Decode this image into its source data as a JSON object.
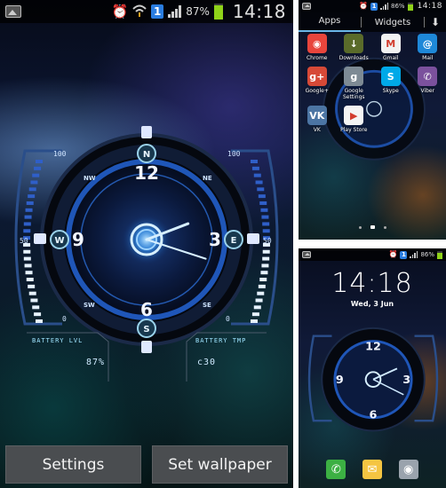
{
  "status_bar": {
    "battery_pct": "87%",
    "battery_pct_small": "86%",
    "time": "14:18",
    "sim_label": "1",
    "icons": [
      "gallery-icon",
      "alarm-icon",
      "wifi-icon",
      "sim-icon",
      "signal-icon",
      "battery-icon"
    ]
  },
  "main_screen": {
    "clock": {
      "numerals": [
        "12",
        "3",
        "6",
        "9"
      ],
      "compass": [
        "N",
        "E",
        "S",
        "W"
      ],
      "directions": [
        "NW",
        "NE",
        "SW",
        "SE"
      ],
      "left_gauge": {
        "top": "100",
        "mid": "50",
        "bottom": "0"
      },
      "right_gauge": {
        "top": "100",
        "mid": "50",
        "bottom": "0"
      },
      "battery_level_label": "BATTERY LVL",
      "battery_level_value": "87%",
      "battery_temp_label": "BATTERY TMP",
      "battery_temp_value": "c30",
      "hour": 14,
      "minute": 18
    },
    "buttons": {
      "settings": "Settings",
      "set_wallpaper": "Set wallpaper"
    }
  },
  "apps_screen": {
    "tabs": {
      "apps": "Apps",
      "widgets": "Widgets",
      "download_icon": "download-icon"
    },
    "apps": [
      {
        "label": "Chrome",
        "icon": "chrome-icon",
        "color": "#e8453c",
        "glyph": "◉"
      },
      {
        "label": "Downloads",
        "icon": "downloads-icon",
        "color": "#5a6b2a",
        "glyph": "↓"
      },
      {
        "label": "Gmail",
        "icon": "gmail-icon",
        "color": "#f2f2f2",
        "glyph": "M"
      },
      {
        "label": "Mail",
        "icon": "mail-icon",
        "color": "#1e88d8",
        "glyph": "@"
      },
      {
        "label": "Google+",
        "icon": "google-plus-icon",
        "color": "#d64937",
        "glyph": "g+"
      },
      {
        "label": "Google Settings",
        "icon": "google-settings-icon",
        "color": "#7d8a94",
        "glyph": "g"
      },
      {
        "label": "Skype",
        "icon": "skype-icon",
        "color": "#00a9e8",
        "glyph": "S"
      },
      {
        "label": "Viber",
        "icon": "viber-icon",
        "color": "#7b519d",
        "glyph": "✆"
      },
      {
        "label": "VK",
        "icon": "vk-icon",
        "color": "#4c75a3",
        "glyph": "VK"
      },
      {
        "label": "Play Store",
        "icon": "play-store-icon",
        "color": "#f4f4f4",
        "glyph": "▶"
      }
    ],
    "page_dots": 3,
    "active_page": 1
  },
  "lock_screen": {
    "time": "14:18",
    "date": "Wed, 3 Jun",
    "dock": [
      {
        "icon": "phone-icon",
        "color": "#3cb043",
        "glyph": "✆"
      },
      {
        "icon": "messages-icon",
        "color": "#f5c542",
        "glyph": "✉"
      },
      {
        "icon": "camera-icon",
        "color": "#9aa3ad",
        "glyph": "◉"
      }
    ]
  }
}
